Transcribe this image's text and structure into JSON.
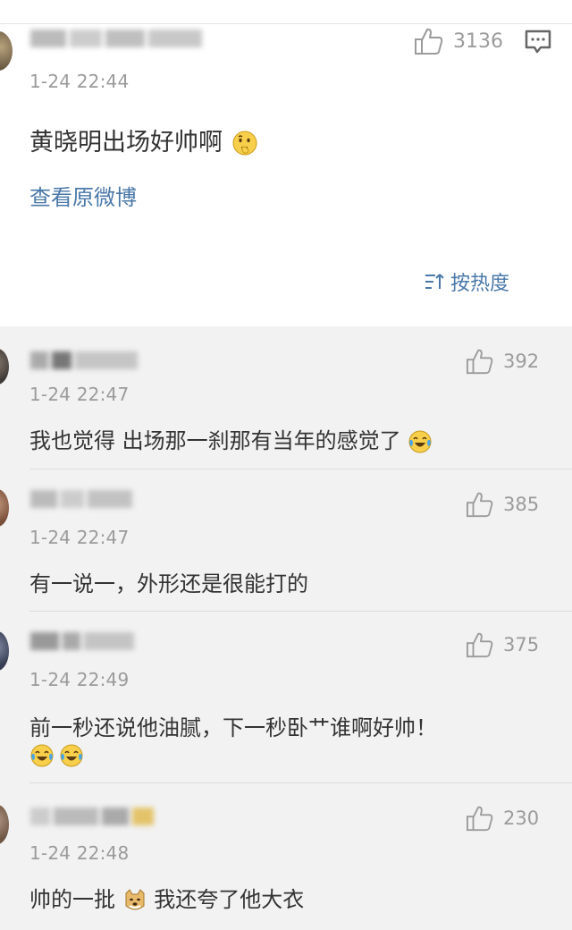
{
  "main_post": {
    "time": "1-24 22:44",
    "likes": "3136",
    "text": "黄晓明出场好帅啊",
    "view_original": "查看原微博",
    "sort_label": "按热度"
  },
  "comments": [
    {
      "time": "1-24 22:47",
      "likes": "392",
      "text": "我也觉得 出场那一刹那有当年的感觉了"
    },
    {
      "time": "1-24 22:47",
      "likes": "385",
      "text": "有一说一，外形还是很能打的"
    },
    {
      "time": "1-24 22:49",
      "likes": "375",
      "text": "前一秒还说他油腻，下一秒卧艹谁啊好帅！"
    },
    {
      "time": "1-24 22:48",
      "likes": "230",
      "text_before": "帅的一批",
      "text_after": "我还夸了他大衣"
    }
  ],
  "colors": {
    "link": "#4a78a8",
    "muted": "#9b9b9b",
    "text": "#333333",
    "comment_bg": "#f2f2f2"
  },
  "icons": {
    "like": "thumbs-up-icon",
    "comment": "comment-icon",
    "sort": "sort-icon",
    "emoji_thinking": "thinking-emoji-icon",
    "emoji_laugh_cry": "laugh-cry-emoji-icon",
    "emoji_doge": "doge-emoji-icon"
  }
}
